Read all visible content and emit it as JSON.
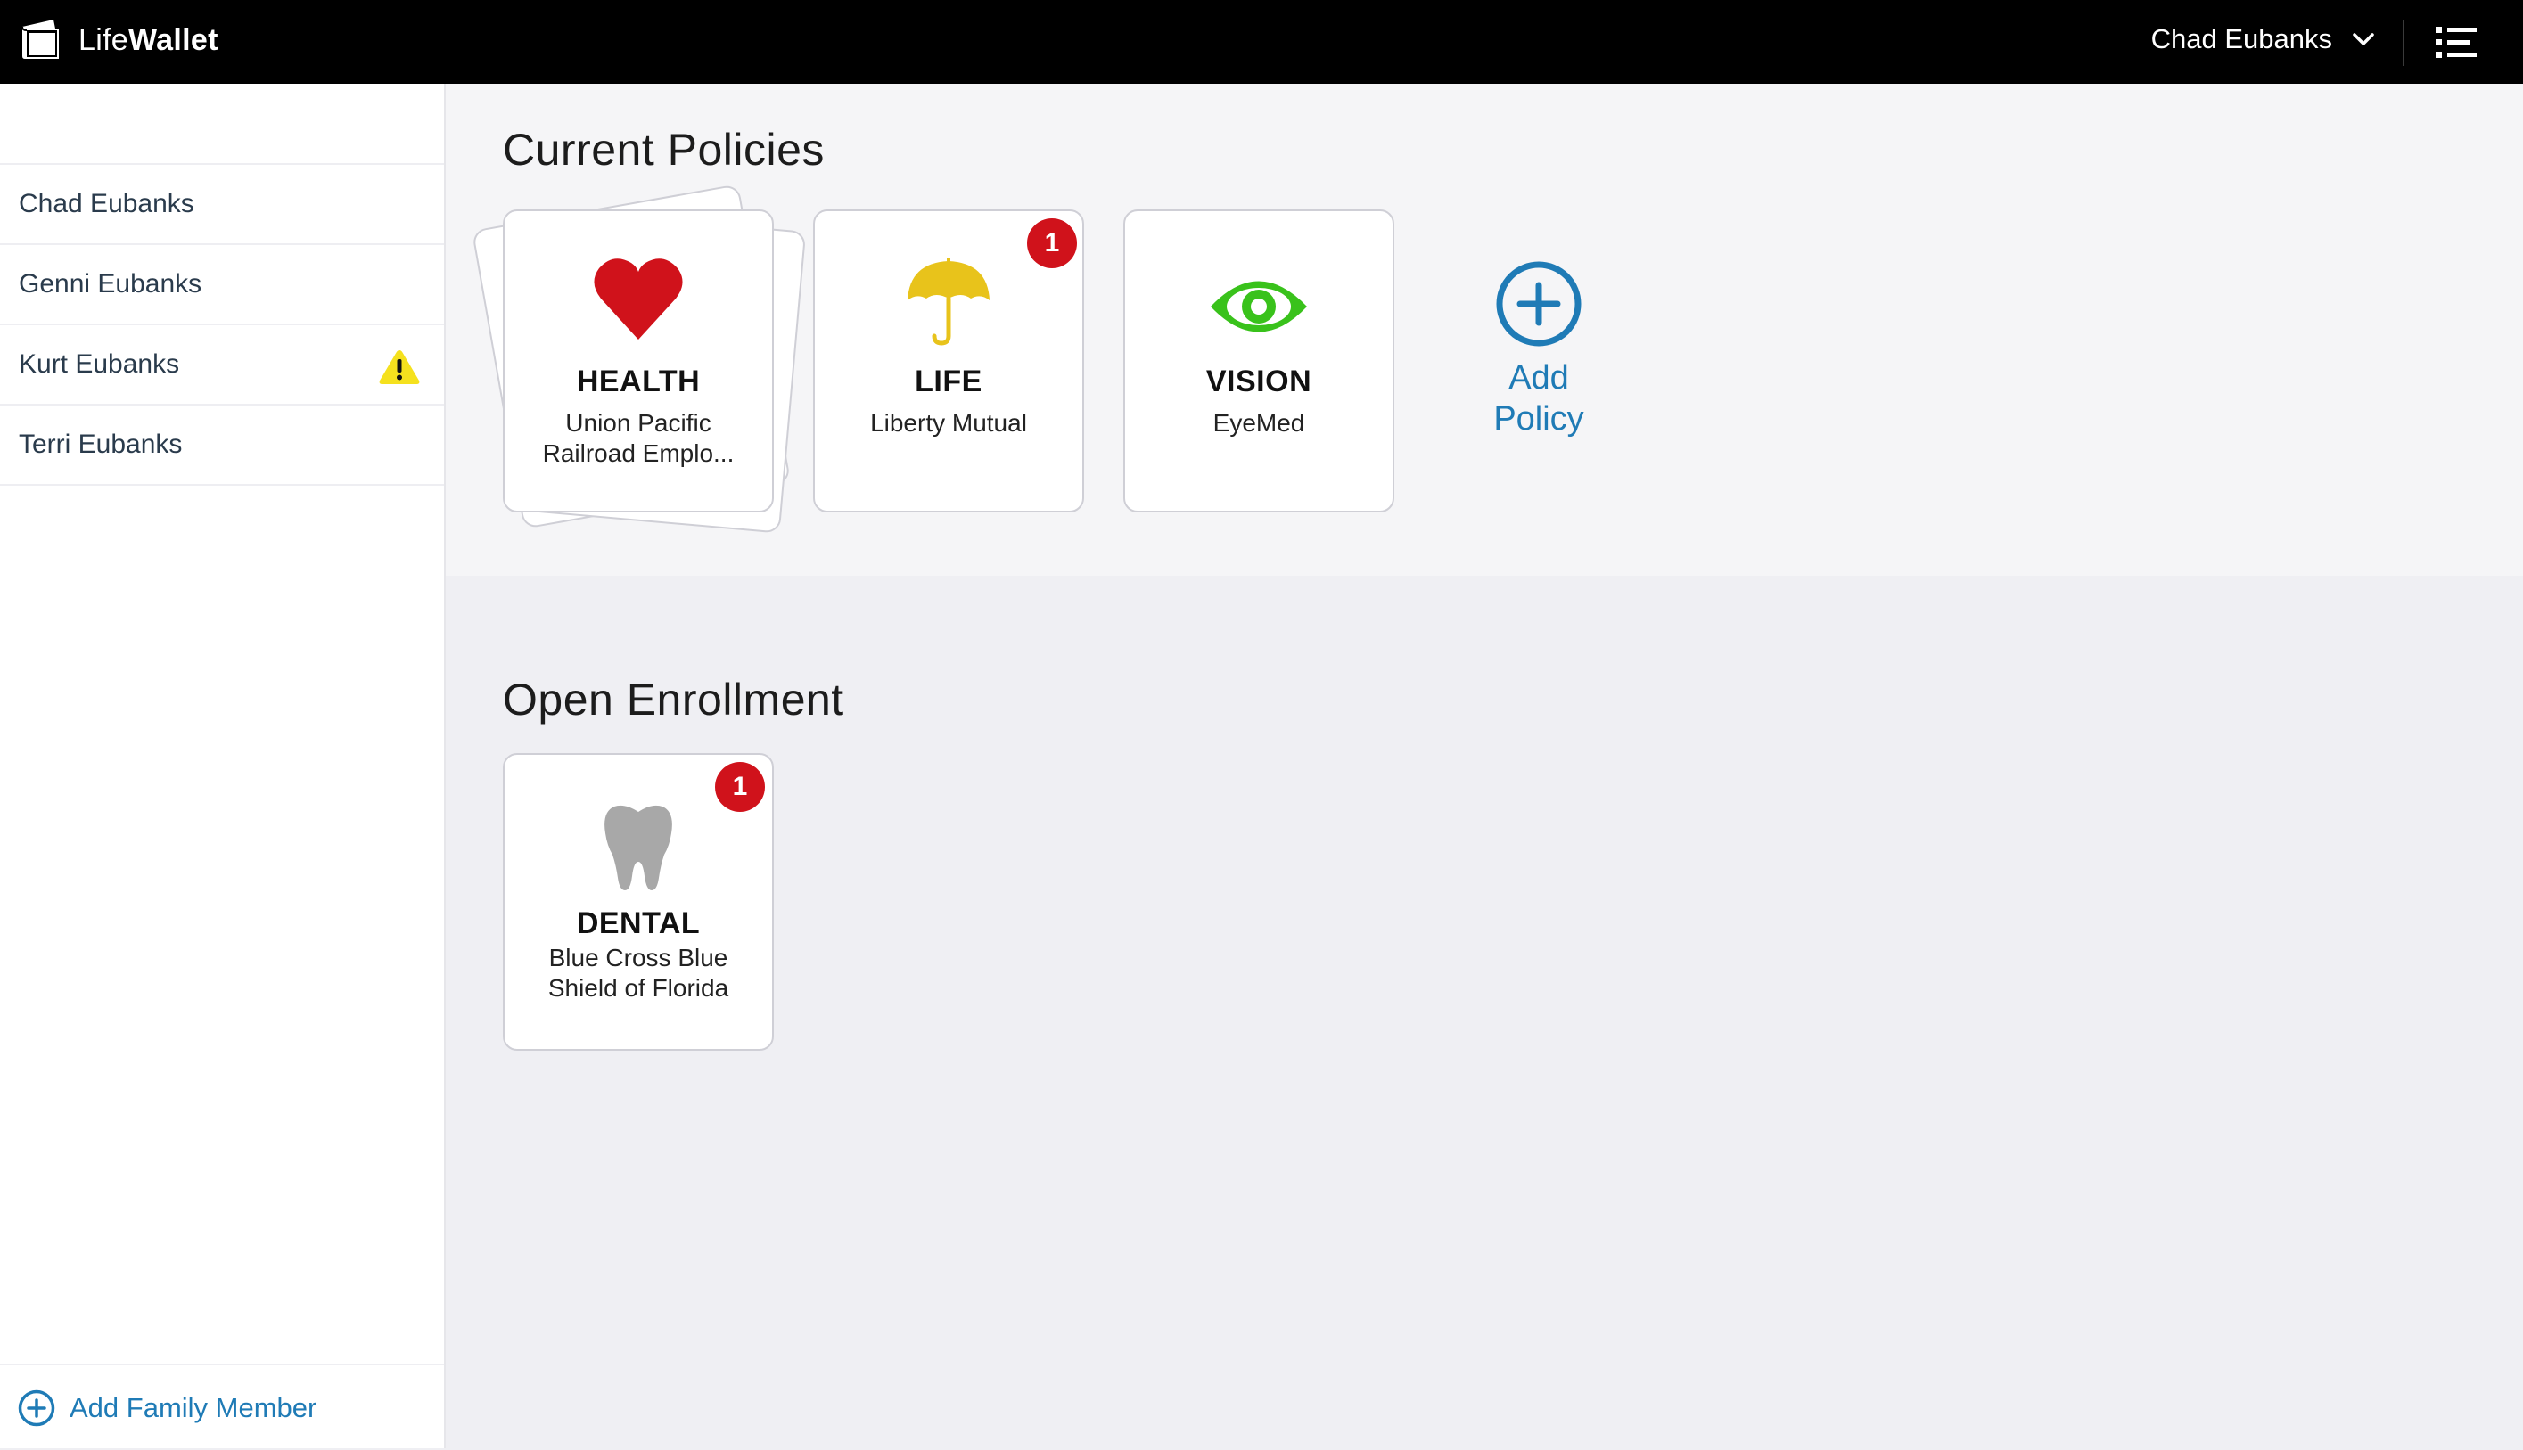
{
  "app": {
    "brand_light": "Life",
    "brand_bold": "Wallet"
  },
  "header": {
    "user_name": "Chad Eubanks"
  },
  "sidebar": {
    "members": [
      {
        "name": "Chad Eubanks",
        "warning": false
      },
      {
        "name": "Genni Eubanks",
        "warning": false
      },
      {
        "name": "Kurt Eubanks",
        "warning": true
      },
      {
        "name": "Terri Eubanks",
        "warning": false
      }
    ],
    "add_member_label": "Add Family Member"
  },
  "current_policies": {
    "title": "Current Policies",
    "cards": [
      {
        "type": "HEALTH",
        "provider": "Union Pacific Railroad Emplo...",
        "icon": "heart-icon",
        "badge": null
      },
      {
        "type": "LIFE",
        "provider": "Liberty Mutual",
        "icon": "umbrella-icon",
        "badge": "1"
      },
      {
        "type": "VISION",
        "provider": "EyeMed",
        "icon": "eye-icon",
        "badge": null
      }
    ],
    "add_policy_label": "Add Policy"
  },
  "open_enrollment": {
    "title": "Open Enrollment",
    "cards": [
      {
        "type": "DENTAL",
        "provider": "Blue Cross Blue Shield of Florida",
        "icon": "tooth-icon",
        "badge": "1"
      }
    ]
  },
  "colors": {
    "accent": "#1f7bb6",
    "badge": "#d0121b",
    "heart": "#d0121b",
    "umbrella": "#e8c31b",
    "eye": "#39c21b",
    "tooth": "#a8a8a8",
    "warning": "#f5e11e"
  }
}
